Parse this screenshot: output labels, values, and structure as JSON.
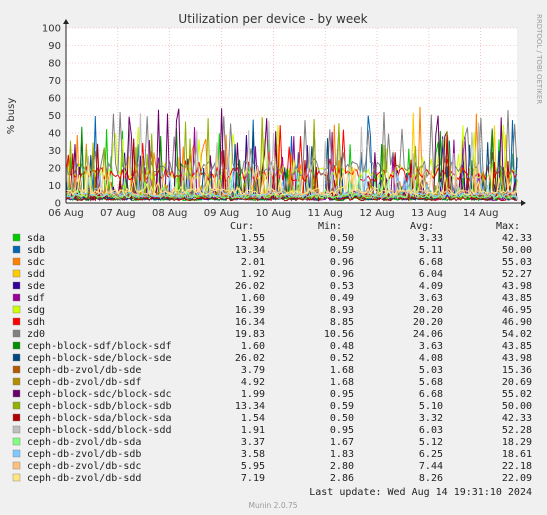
{
  "chart_data": {
    "type": "line",
    "title": "Utilization per device - by week",
    "ylabel": "% busy",
    "xlabel": "",
    "ylim": [
      0,
      100
    ],
    "y_ticks": [
      0,
      10,
      20,
      30,
      40,
      50,
      60,
      70,
      80,
      90,
      100
    ],
    "x_ticks": [
      "06 Aug",
      "07 Aug",
      "08 Aug",
      "09 Aug",
      "10 Aug",
      "11 Aug",
      "12 Aug",
      "13 Aug",
      "14 Aug"
    ],
    "grid": true,
    "legend_headers": {
      "cur": "Cur:",
      "min": "Min:",
      "avg": "Avg:",
      "max": "Max:"
    },
    "series": [
      {
        "name": "sda",
        "color": "#00cc00",
        "cur": "1.55",
        "min": "0.50",
        "avg": "3.33",
        "max": "42.33"
      },
      {
        "name": "sdb",
        "color": "#0066b3",
        "cur": "13.34",
        "min": "0.59",
        "avg": "5.11",
        "max": "50.00"
      },
      {
        "name": "sdc",
        "color": "#ff8000",
        "cur": "2.01",
        "min": "0.96",
        "avg": "6.68",
        "max": "55.03"
      },
      {
        "name": "sdd",
        "color": "#ffcc00",
        "cur": "1.92",
        "min": "0.96",
        "avg": "6.04",
        "max": "52.27"
      },
      {
        "name": "sde",
        "color": "#330099",
        "cur": "26.02",
        "min": "0.53",
        "avg": "4.09",
        "max": "43.98"
      },
      {
        "name": "sdf",
        "color": "#990099",
        "cur": "1.60",
        "min": "0.49",
        "avg": "3.63",
        "max": "43.85"
      },
      {
        "name": "sdg",
        "color": "#ccff00",
        "cur": "16.39",
        "min": "8.93",
        "avg": "20.20",
        "max": "46.95"
      },
      {
        "name": "sdh",
        "color": "#ff0000",
        "cur": "16.34",
        "min": "8.85",
        "avg": "20.20",
        "max": "46.90"
      },
      {
        "name": "zd0",
        "color": "#808080",
        "cur": "19.83",
        "min": "10.56",
        "avg": "24.06",
        "max": "54.02"
      },
      {
        "name": "ceph-block-sdf/block-sdf",
        "color": "#008f00",
        "cur": "1.60",
        "min": "0.48",
        "avg": "3.63",
        "max": "43.85"
      },
      {
        "name": "ceph-block-sde/block-sde",
        "color": "#00487d",
        "cur": "26.02",
        "min": "0.52",
        "avg": "4.08",
        "max": "43.98"
      },
      {
        "name": "ceph-db-zvol/db-sde",
        "color": "#b35a00",
        "cur": "3.79",
        "min": "1.68",
        "avg": "5.03",
        "max": "15.36"
      },
      {
        "name": "ceph-db-zvol/db-sdf",
        "color": "#b38f00",
        "cur": "4.92",
        "min": "1.68",
        "avg": "5.68",
        "max": "20.69"
      },
      {
        "name": "ceph-block-sdc/block-sdc",
        "color": "#6b006b",
        "cur": "1.99",
        "min": "0.95",
        "avg": "6.68",
        "max": "55.02"
      },
      {
        "name": "ceph-block-sdb/block-sdb",
        "color": "#8fb300",
        "cur": "13.34",
        "min": "0.59",
        "avg": "5.10",
        "max": "50.00"
      },
      {
        "name": "ceph-block-sda/block-sda",
        "color": "#b30000",
        "cur": "1.54",
        "min": "0.50",
        "avg": "3.32",
        "max": "42.33"
      },
      {
        "name": "ceph-block-sdd/block-sdd",
        "color": "#bebebe",
        "cur": "1.91",
        "min": "0.95",
        "avg": "6.03",
        "max": "52.28"
      },
      {
        "name": "ceph-db-zvol/db-sda",
        "color": "#80ff80",
        "cur": "3.37",
        "min": "1.67",
        "avg": "5.12",
        "max": "18.29"
      },
      {
        "name": "ceph-db-zvol/db-sdb",
        "color": "#80c9ff",
        "cur": "3.58",
        "min": "1.83",
        "avg": "6.25",
        "max": "18.61"
      },
      {
        "name": "ceph-db-zvol/db-sdc",
        "color": "#ffc080",
        "cur": "5.95",
        "min": "2.80",
        "avg": "7.44",
        "max": "22.18"
      },
      {
        "name": "ceph-db-zvol/db-sdd",
        "color": "#ffe680",
        "cur": "7.19",
        "min": "2.86",
        "avg": "8.26",
        "max": "22.09"
      }
    ]
  },
  "footer": {
    "last_update": "Last update:  Wed Aug 14 19:31:10 2024",
    "version": "Munin 2.0.75"
  },
  "side_label": "RRDTOOL / TOBI OETIKER"
}
